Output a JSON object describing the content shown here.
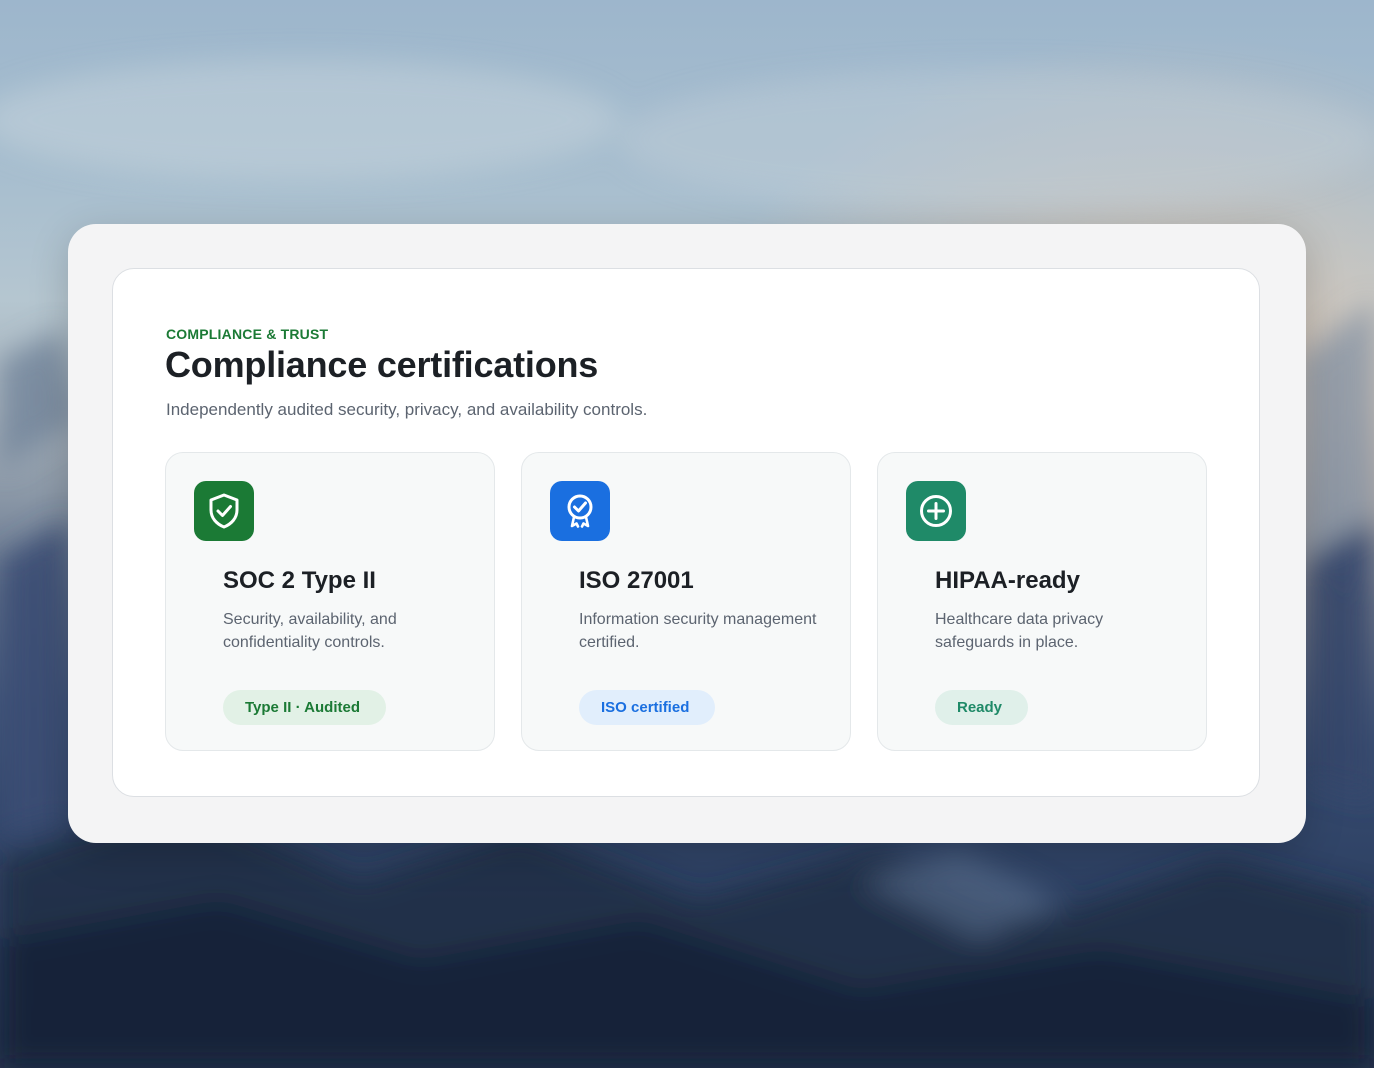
{
  "section": {
    "eyebrow": "COMPLIANCE & TRUST",
    "title": "Compliance certifications",
    "subtitle": "Independently audited security, privacy, and availability controls."
  },
  "certifications": [
    {
      "title": "SOC 2 Type II",
      "description": "Security, availability, and confidentiality controls.",
      "badge": "Type II · Audited",
      "icon": "shield-check-icon",
      "icon_color": "#1b7a35",
      "badge_bg": "#e2f1e6",
      "badge_color": "#1b7a35"
    },
    {
      "title": "ISO 27001",
      "description": "Information security management certified.",
      "badge": "ISO certified",
      "icon": "award-ribbon-icon",
      "icon_color": "#1a6fe0",
      "badge_bg": "#e1eefc",
      "badge_color": "#1a6fe0"
    },
    {
      "title": "HIPAA-ready",
      "description": "Healthcare data privacy safeguards in place.",
      "badge": "Ready",
      "icon": "plus-circle-icon",
      "icon_color": "#1f8a68",
      "badge_bg": "#e0f0ea",
      "badge_color": "#1f8a68"
    }
  ]
}
